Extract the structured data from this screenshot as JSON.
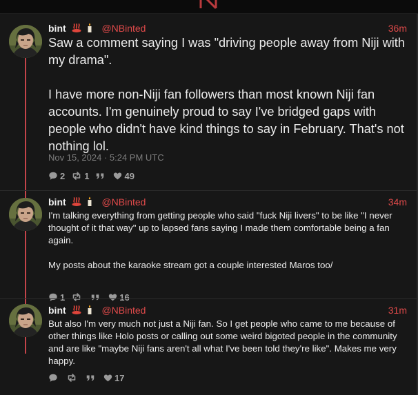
{
  "colors": {
    "accent": "#e04a4a",
    "thread_line": "#c4444a",
    "background": "#171717"
  },
  "posts": [
    {
      "author": "bint",
      "emojis": [
        "hot-springs-icon",
        "candle-icon"
      ],
      "handle": "@NBinted",
      "time": "36m",
      "text": "Saw a comment saying I was \"driving people away from Niji with my drama\".\n\nI have more non-Niji fan followers than most known Niji fan accounts. I'm genuinely proud to say I've bridged gaps with people who didn't have kind things to say in February. That's not nothing lol.",
      "timestamp": "Nov 15, 2024 · 5:24 PM UTC",
      "replies": "2",
      "reposts": "1",
      "quotes": "",
      "likes": "49"
    },
    {
      "author": "bint",
      "emojis": [
        "hot-springs-icon",
        "candle-icon"
      ],
      "handle": "@NBinted",
      "time": "34m",
      "text": "I'm talking everything from getting people who said \"fuck Niji livers\" to be like \"I never thought of it that way\" up to lapsed fans saying I made them comfortable being a fan again.\n\nMy posts about the karaoke stream got a couple interested Maros too/",
      "replies": "1",
      "reposts": "",
      "quotes": "",
      "likes": "16"
    },
    {
      "author": "bint",
      "emojis": [
        "hot-springs-icon",
        "candle-icon"
      ],
      "handle": "@NBinted",
      "time": "31m",
      "text": "But also I'm very much not just a Niji fan. So I get people who came to me because of other things like Holo posts or calling out some weird bigoted people in the community and are like \"maybe Niji fans aren't all what I've been told they're like\". Makes me very happy.",
      "replies": "",
      "reposts": "",
      "quotes": "",
      "likes": "17"
    }
  ]
}
